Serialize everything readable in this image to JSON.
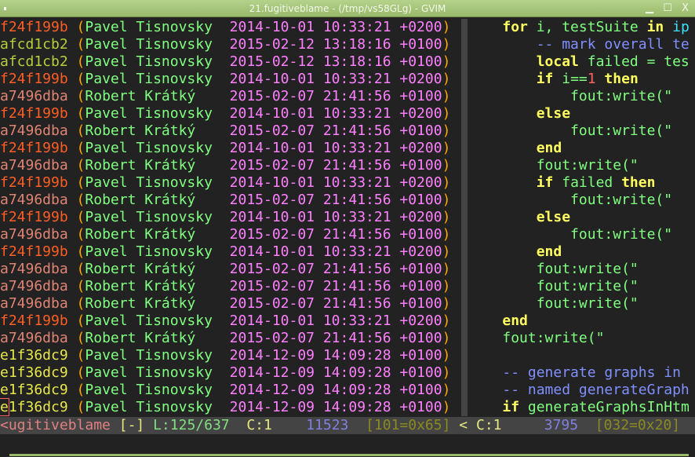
{
  "window": {
    "title": "21.fugitiveblame - (/tmp/vs58GLg) - GVIM",
    "controls": "▁ ☐ X"
  },
  "blame": [
    {
      "hash": "f24f199b",
      "author": "Pavel Tisnovsky",
      "date": "2014-10-01 10:33:21 +0200"
    },
    {
      "hash": "afcd1cb2",
      "author": "Pavel Tisnovsky",
      "date": "2015-02-12 13:18:16 +0100"
    },
    {
      "hash": "afcd1cb2",
      "author": "Pavel Tisnovsky",
      "date": "2015-02-12 13:18:16 +0100"
    },
    {
      "hash": "f24f199b",
      "author": "Pavel Tisnovsky",
      "date": "2014-10-01 10:33:21 +0200"
    },
    {
      "hash": "a7496dba",
      "author": "Robert Krátký  ",
      "date": "2015-02-07 21:41:56 +0100"
    },
    {
      "hash": "f24f199b",
      "author": "Pavel Tisnovsky",
      "date": "2014-10-01 10:33:21 +0200"
    },
    {
      "hash": "a7496dba",
      "author": "Robert Krátký  ",
      "date": "2015-02-07 21:41:56 +0100"
    },
    {
      "hash": "f24f199b",
      "author": "Pavel Tisnovsky",
      "date": "2014-10-01 10:33:21 +0200"
    },
    {
      "hash": "a7496dba",
      "author": "Robert Krátký  ",
      "date": "2015-02-07 21:41:56 +0100"
    },
    {
      "hash": "f24f199b",
      "author": "Pavel Tisnovsky",
      "date": "2014-10-01 10:33:21 +0200"
    },
    {
      "hash": "a7496dba",
      "author": "Robert Krátký  ",
      "date": "2015-02-07 21:41:56 +0100"
    },
    {
      "hash": "f24f199b",
      "author": "Pavel Tisnovsky",
      "date": "2014-10-01 10:33:21 +0200"
    },
    {
      "hash": "a7496dba",
      "author": "Robert Krátký  ",
      "date": "2015-02-07 21:41:56 +0100"
    },
    {
      "hash": "f24f199b",
      "author": "Pavel Tisnovsky",
      "date": "2014-10-01 10:33:21 +0200"
    },
    {
      "hash": "a7496dba",
      "author": "Robert Krátký  ",
      "date": "2015-02-07 21:41:56 +0100"
    },
    {
      "hash": "a7496dba",
      "author": "Robert Krátký  ",
      "date": "2015-02-07 21:41:56 +0100"
    },
    {
      "hash": "a7496dba",
      "author": "Robert Krátký  ",
      "date": "2015-02-07 21:41:56 +0100"
    },
    {
      "hash": "f24f199b",
      "author": "Pavel Tisnovsky",
      "date": "2014-10-01 10:33:21 +0200"
    },
    {
      "hash": "a7496dba",
      "author": "Robert Krátký  ",
      "date": "2015-02-07 21:41:56 +0100"
    },
    {
      "hash": "e1f36dc9",
      "author": "Pavel Tisnovsky",
      "date": "2014-12-09 14:09:28 +0100"
    },
    {
      "hash": "e1f36dc9",
      "author": "Pavel Tisnovsky",
      "date": "2014-12-09 14:09:28 +0100"
    },
    {
      "hash": "e1f36dc9",
      "author": "Pavel Tisnovsky",
      "date": "2014-12-09 14:09:28 +0100"
    },
    {
      "hash": "e1f36dc9",
      "author": "Pavel Tisnovsky",
      "date": "2014-12-09 14:09:28 +0100"
    }
  ],
  "code": [
    [
      [
        "",
        "    "
      ],
      [
        "kw",
        "for"
      ],
      [
        "id",
        " i, testSuite "
      ],
      [
        "kw",
        "in"
      ],
      [
        "cy",
        " ip"
      ]
    ],
    [
      [
        "",
        "        "
      ],
      [
        "cm",
        "-- mark overall te"
      ]
    ],
    [
      [
        "",
        "        "
      ],
      [
        "kw",
        "local"
      ],
      [
        "id",
        " failed = tes"
      ]
    ],
    [
      [
        "",
        "        "
      ],
      [
        "kw",
        "if"
      ],
      [
        "id",
        " i=="
      ],
      [
        "num",
        "1"
      ],
      [
        "kw",
        " then"
      ]
    ],
    [
      [
        "",
        "            "
      ],
      [
        "id",
        "fout:write(\""
      ]
    ],
    [
      [
        "",
        "        "
      ],
      [
        "kw",
        "else"
      ]
    ],
    [
      [
        "",
        "            "
      ],
      [
        "id",
        "fout:write(\""
      ]
    ],
    [
      [
        "",
        "        "
      ],
      [
        "kw",
        "end"
      ]
    ],
    [
      [
        "",
        "        "
      ],
      [
        "id",
        "fout:write(\""
      ]
    ],
    [
      [
        "",
        "        "
      ],
      [
        "kw",
        "if"
      ],
      [
        "id",
        " failed "
      ],
      [
        "kw",
        "then"
      ]
    ],
    [
      [
        "",
        "            "
      ],
      [
        "id",
        "fout:write(\""
      ]
    ],
    [
      [
        "",
        "        "
      ],
      [
        "kw",
        "else"
      ]
    ],
    [
      [
        "",
        "            "
      ],
      [
        "id",
        "fout:write(\""
      ]
    ],
    [
      [
        "",
        "        "
      ],
      [
        "kw",
        "end"
      ]
    ],
    [
      [
        "",
        "        "
      ],
      [
        "id",
        "fout:write(\""
      ]
    ],
    [
      [
        "",
        "        "
      ],
      [
        "id",
        "fout:write(\""
      ]
    ],
    [
      [
        "",
        "        "
      ],
      [
        "id",
        "fout:write(\""
      ]
    ],
    [
      [
        "",
        "    "
      ],
      [
        "kw",
        "end"
      ]
    ],
    [
      [
        "",
        "    "
      ],
      [
        "id",
        "fout:write(\""
      ]
    ],
    [],
    [
      [
        "",
        "    "
      ],
      [
        "cm",
        "-- generate graphs in"
      ]
    ],
    [
      [
        "",
        "    "
      ],
      [
        "cm",
        "-- named generateGraph"
      ]
    ],
    [
      [
        "",
        "    "
      ],
      [
        "kw",
        "if"
      ],
      [
        "id",
        " generateGraphsInHtm"
      ]
    ]
  ],
  "status": {
    "left_name": "<ugitiveblame",
    "left_flag": "[-]",
    "left_line": "L:125/637",
    "left_col": "C:1",
    "left_offset": "11523",
    "left_char": "[101=0x65]",
    "right_name": "<",
    "right_col": "C:1",
    "right_offset": "3795",
    "right_char": "[032=0x20]"
  }
}
